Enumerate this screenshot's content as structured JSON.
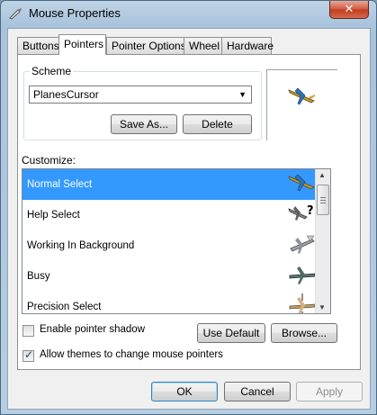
{
  "window": {
    "title": "Mouse Properties",
    "close_label": "✕",
    "title_icon": "mouse-cursor-icon"
  },
  "tabs": [
    {
      "label": "Buttons",
      "active": false
    },
    {
      "label": "Pointers",
      "active": true
    },
    {
      "label": "Pointer Options",
      "active": false
    },
    {
      "label": "Wheel",
      "active": false
    },
    {
      "label": "Hardware",
      "active": false
    }
  ],
  "scheme": {
    "group_label": "Scheme",
    "selected": "PlanesCursor",
    "save_as_label": "Save As...",
    "delete_label": "Delete"
  },
  "customize": {
    "label": "Customize:",
    "items": [
      {
        "label": "Normal Select",
        "selected": true,
        "icon": "plane-normal-select-icon"
      },
      {
        "label": "Help Select",
        "selected": false,
        "icon": "plane-help-select-icon"
      },
      {
        "label": "Working In Background",
        "selected": false,
        "icon": "plane-working-background-icon"
      },
      {
        "label": "Busy",
        "selected": false,
        "icon": "plane-busy-icon"
      },
      {
        "label": "Precision Select",
        "selected": false,
        "icon": "plane-precision-select-icon"
      }
    ]
  },
  "options": {
    "enable_shadow_label": "Enable pointer shadow",
    "enable_shadow_checked": false,
    "allow_themes_label": "Allow themes to change mouse pointers",
    "allow_themes_checked": true,
    "use_default_label": "Use Default",
    "browse_label": "Browse..."
  },
  "footer": {
    "ok_label": "OK",
    "cancel_label": "Cancel",
    "apply_label": "Apply"
  },
  "colors": {
    "selection": "#3399ff",
    "close_button": "#c8452a"
  }
}
